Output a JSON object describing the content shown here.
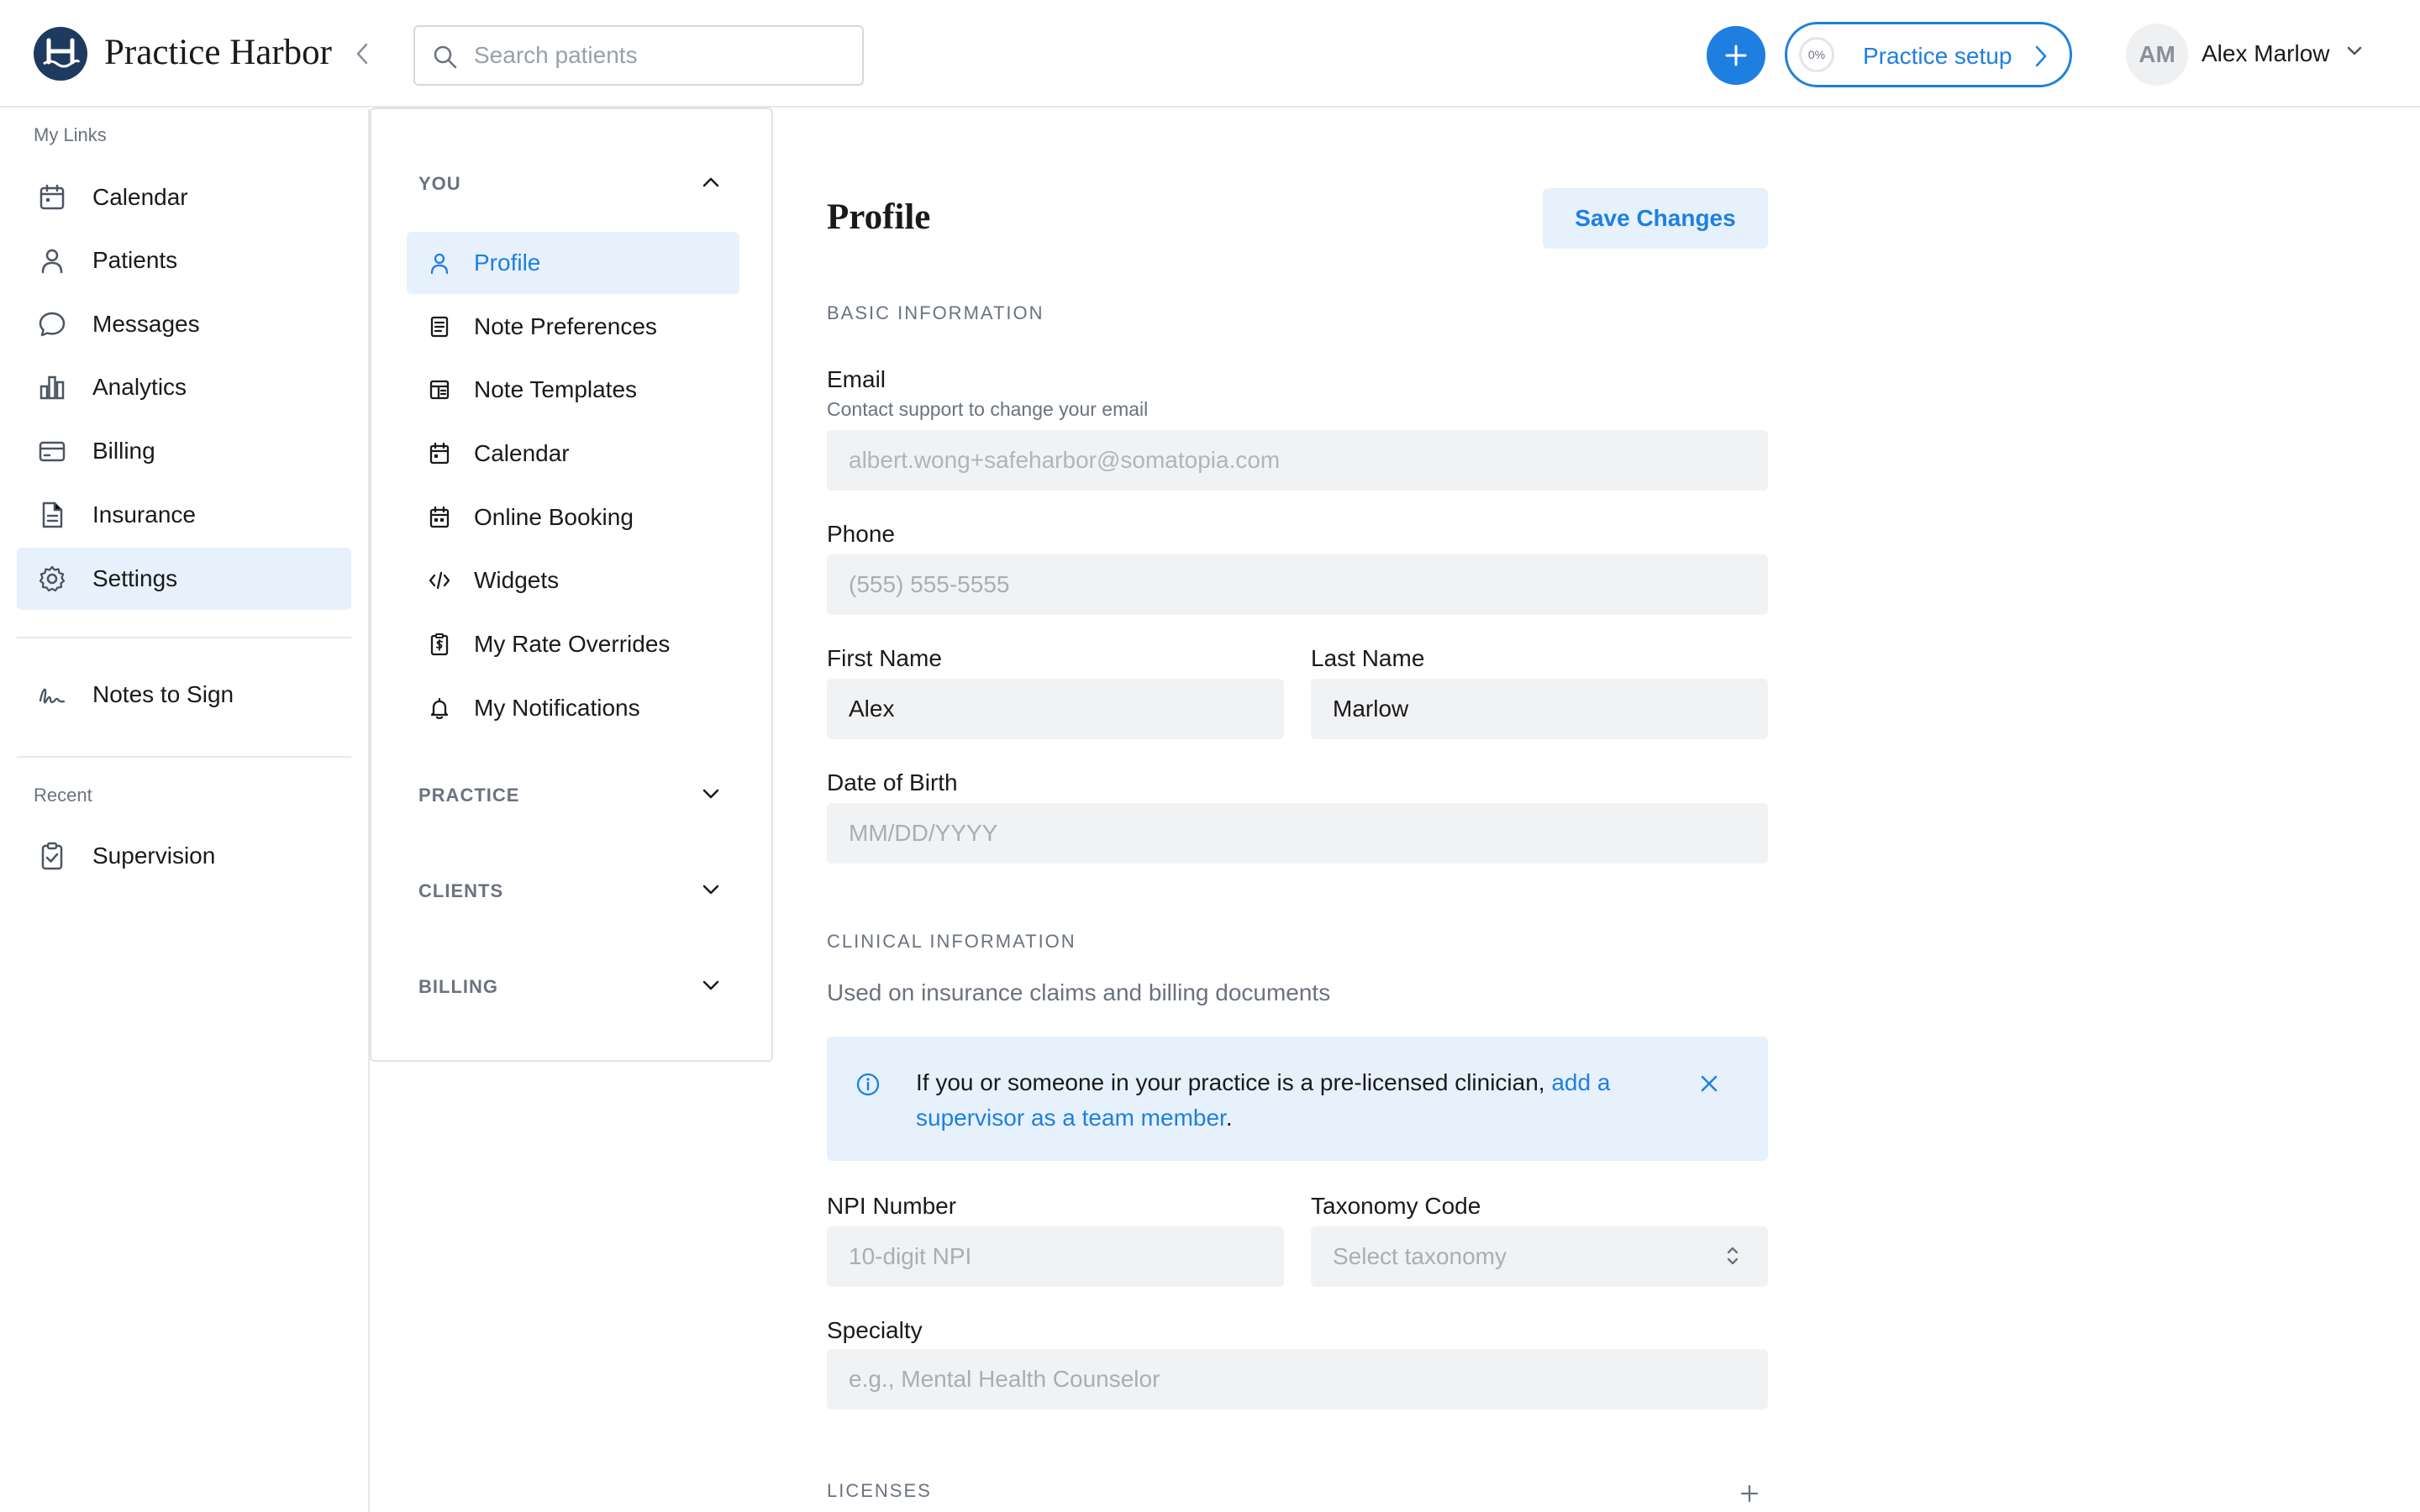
{
  "app": {
    "brand": "Practice Harbor",
    "accent_color": "#1f7fe0",
    "logo_color": "#1e3a5f"
  },
  "header": {
    "search_placeholder": "Search patients",
    "setup_progress": "0%",
    "setup_label": "Practice setup",
    "user_initials": "AM",
    "user_name": "Alex Marlow"
  },
  "sidebar": {
    "my_links_label": "My Links",
    "items": [
      {
        "label": "Calendar",
        "icon": "calendar-icon"
      },
      {
        "label": "Patients",
        "icon": "person-icon"
      },
      {
        "label": "Messages",
        "icon": "chat-bubble-icon"
      },
      {
        "label": "Analytics",
        "icon": "bar-chart-icon"
      },
      {
        "label": "Billing",
        "icon": "credit-card-icon"
      },
      {
        "label": "Insurance",
        "icon": "document-icon"
      },
      {
        "label": "Settings",
        "icon": "gear-icon",
        "active": true
      }
    ],
    "notes_to_sign": "Notes to Sign",
    "recent_label": "Recent",
    "recent_items": [
      {
        "label": "Supervision",
        "icon": "clipboard-check-icon"
      }
    ]
  },
  "settings_nav": {
    "groups": [
      {
        "label": "YOU",
        "expanded": true
      },
      {
        "label": "PRACTICE",
        "expanded": false
      },
      {
        "label": "CLIENTS",
        "expanded": false
      },
      {
        "label": "BILLING",
        "expanded": false
      }
    ],
    "you_items": [
      {
        "label": "Profile",
        "icon": "person-icon",
        "active": true
      },
      {
        "label": "Note Preferences",
        "icon": "note-icon"
      },
      {
        "label": "Note Templates",
        "icon": "template-icon"
      },
      {
        "label": "Calendar",
        "icon": "calendar-icon"
      },
      {
        "label": "Online Booking",
        "icon": "calendar-booking-icon"
      },
      {
        "label": "Widgets",
        "icon": "code-icon"
      },
      {
        "label": "My Rate Overrides",
        "icon": "dollar-clipboard-icon"
      },
      {
        "label": "My Notifications",
        "icon": "bell-icon"
      }
    ]
  },
  "profile": {
    "title": "Profile",
    "save_label": "Save Changes",
    "basic_section": "BASIC INFORMATION",
    "email": {
      "label": "Email",
      "help": "Contact support to change your email",
      "value": "albert.wong+safeharbor@somatopia.com"
    },
    "phone": {
      "label": "Phone",
      "placeholder": "(555) 555-5555"
    },
    "first_name": {
      "label": "First Name",
      "value": "Alex"
    },
    "last_name": {
      "label": "Last Name",
      "value": "Marlow"
    },
    "dob": {
      "label": "Date of Birth",
      "placeholder": "MM/DD/YYYY"
    },
    "clinical_section": "CLINICAL INFORMATION",
    "clinical_desc": "Used on insurance claims and billing documents",
    "alert": {
      "text": "If you or someone in your practice is a pre-licensed clinician, ",
      "link": "add a supervisor as a team member",
      "end": "."
    },
    "npi": {
      "label": "NPI Number",
      "placeholder": "10-digit NPI"
    },
    "taxonomy": {
      "label": "Taxonomy Code",
      "placeholder": "Select taxonomy"
    },
    "specialty": {
      "label": "Specialty",
      "placeholder": "e.g., Mental Health Counselor"
    },
    "licenses_section": "LICENSES"
  }
}
